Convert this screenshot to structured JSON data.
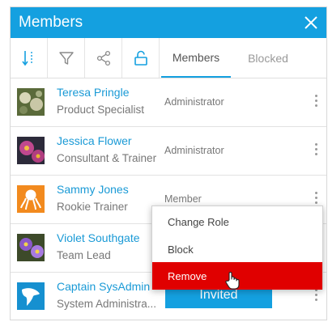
{
  "window": {
    "title": "Members",
    "close_icon": "close-icon"
  },
  "toolbar": {
    "icons": [
      "sort-icon",
      "filter-icon",
      "share-icon",
      "unlock-icon"
    ],
    "tabs": [
      {
        "label": "Members",
        "active": true
      },
      {
        "label": "Blocked",
        "active": false
      }
    ]
  },
  "members": [
    {
      "name": "Teresa Pringle",
      "job": "Product Specialist",
      "role": "Administrator"
    },
    {
      "name": "Jessica Flower",
      "job": "Consultant & Trainer",
      "role": "Administrator"
    },
    {
      "name": "Sammy Jones",
      "job": "Rookie Trainer",
      "role": "Member"
    },
    {
      "name": "Violet Southgate",
      "job": "Team Lead",
      "role": ""
    },
    {
      "name": "Captain SysAdmin",
      "job": "System Administra...",
      "role": "",
      "status_button": "Invited"
    }
  ],
  "context_menu": {
    "items": [
      {
        "label": "Change Role"
      },
      {
        "label": "Block"
      },
      {
        "label": "Remove",
        "highlighted": true
      }
    ]
  },
  "colors": {
    "accent": "#14a0e0",
    "danger": "#e00000",
    "name_link": "#1a9ad6"
  }
}
